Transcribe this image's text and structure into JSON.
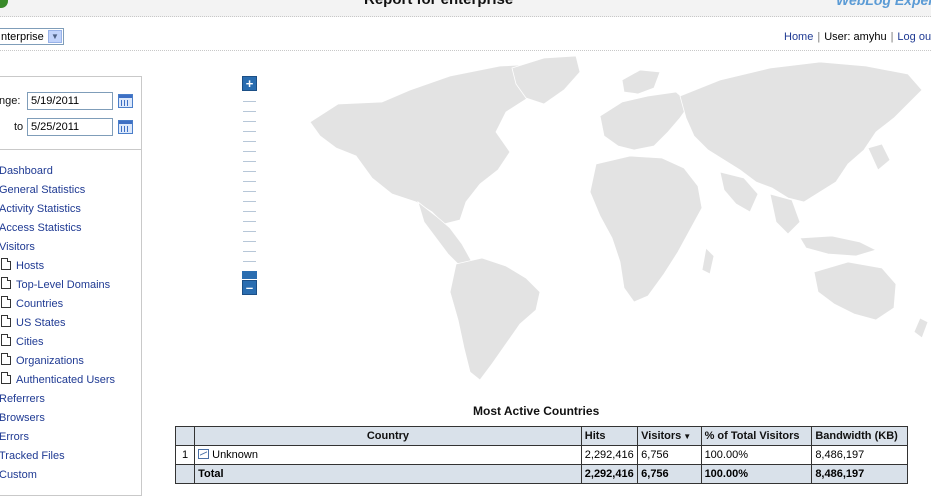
{
  "header": {
    "title": "Report for enterprise",
    "brand": "WebLog Exper"
  },
  "profile": {
    "selected": "nterprise",
    "links": {
      "home": "Home",
      "user": "User: amyhu",
      "logout": "Log ou"
    }
  },
  "date_range": {
    "from_label": "nge:",
    "from_value": "5/19/2011",
    "to_label": "to",
    "to_value": "5/25/2011"
  },
  "nav": {
    "items": [
      {
        "label": "Dashboard",
        "sub": false
      },
      {
        "label": "General Statistics",
        "sub": false
      },
      {
        "label": "Activity Statistics",
        "sub": false
      },
      {
        "label": "Access Statistics",
        "sub": false
      },
      {
        "label": "Visitors",
        "sub": false
      },
      {
        "label": "Hosts",
        "sub": true
      },
      {
        "label": "Top-Level Domains",
        "sub": true
      },
      {
        "label": "Countries",
        "sub": true
      },
      {
        "label": "US States",
        "sub": true
      },
      {
        "label": "Cities",
        "sub": true
      },
      {
        "label": "Organizations",
        "sub": true
      },
      {
        "label": "Authenticated Users",
        "sub": true
      },
      {
        "label": "Referrers",
        "sub": false
      },
      {
        "label": "Browsers",
        "sub": false
      },
      {
        "label": "Errors",
        "sub": false
      },
      {
        "label": "Tracked Files",
        "sub": false
      },
      {
        "label": "Custom",
        "sub": false
      }
    ]
  },
  "map": {
    "zoom_in": "+",
    "zoom_out": "–",
    "land_color": "#e3e3e3"
  },
  "table": {
    "title": "Most Active Countries",
    "columns": [
      "",
      "Country",
      "Hits",
      "Visitors",
      "% of Total Visitors",
      "Bandwidth (KB)"
    ],
    "sort_indicator": "▼",
    "rows": [
      {
        "rank": "1",
        "country": "Unknown",
        "hits": "2,292,416",
        "visitors": "6,756",
        "pct": "100.00%",
        "bandwidth": "8,486,197"
      }
    ],
    "total": {
      "label": "Total",
      "hits": "2,292,416",
      "visitors": "6,756",
      "pct": "100.00%",
      "bandwidth": "8,486,197"
    }
  }
}
